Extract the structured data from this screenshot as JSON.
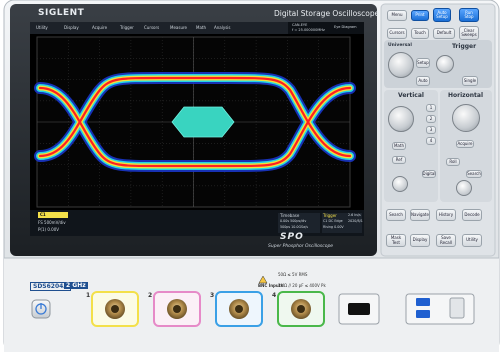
{
  "brand": {
    "name": "SIGLENT"
  },
  "header": {
    "product_title": "Digital Storage Oscilloscope"
  },
  "screen": {
    "menu": [
      "Utility",
      "Display",
      "Acquire",
      "Trigger",
      "Cursors",
      "Measure",
      "Math",
      "Analysis"
    ],
    "top_right_1": "CAN-EYE",
    "top_right_2": "f = 25.000000MHz",
    "top_right_3": "Eye Diagram",
    "bottom_left_1": "C1",
    "bottom_left_2": "FS  500mV/div",
    "bottom_left_3": "P(1)  0.00V",
    "timebase_label": "Timebase",
    "timebase_1": "0.00s  500ps/div",
    "timebase_2": "500ps  10.0GSa/s",
    "trigger_label": "Trigger",
    "trigger_1": "C1 DC  Edge",
    "trigger_2": "Rising  0.00V",
    "samples_label": "2.6 ks/s",
    "samples_2": "2020/8/1"
  },
  "right_panel": {
    "buttons_top": [
      "Menu",
      "Print",
      "Auto Setup",
      "Run Stop",
      "Cursors",
      "Touch",
      "Default",
      "Clear Sweeps"
    ],
    "universal_label": "Universal",
    "trigger_label": "Trigger",
    "trigger_buttons": [
      "Setup",
      "Auto",
      "Single"
    ],
    "vertical_label": "Vertical",
    "horizontal_label": "Horizontal",
    "channel_buttons": [
      "1",
      "2",
      "3",
      "4"
    ],
    "vertical_buttons": [
      "Math",
      "Ref",
      "Digital"
    ],
    "horizontal_buttons": [
      "Acquire",
      "Roll",
      "Search"
    ],
    "bottom_buttons": [
      "Search",
      "Navigate",
      "History",
      "Decode",
      "Mask Test",
      "Display",
      "Save Recall",
      "Utility"
    ]
  },
  "logo_spo": "SPO",
  "logo_spo_sub": "Super Phosphor Oscilloscope",
  "front": {
    "model": "SDS6204A",
    "bandwidth": "2 GHz",
    "warning_1": "50Ω ≤ 5V RMS",
    "warning_2": "BNC Inputs",
    "warning_3": "1MΩ // 20 pF ≤ 400V Pk",
    "channels": [
      "1",
      "2",
      "3",
      "4"
    ]
  },
  "colors": {
    "ch1": "#f3e04a",
    "ch2": "#e68ac8",
    "ch3": "#3aa0e6",
    "ch4": "#4ab84a",
    "body": "#e7eaed",
    "screen_bg": "#000000",
    "accent": "#1a6fd6"
  }
}
